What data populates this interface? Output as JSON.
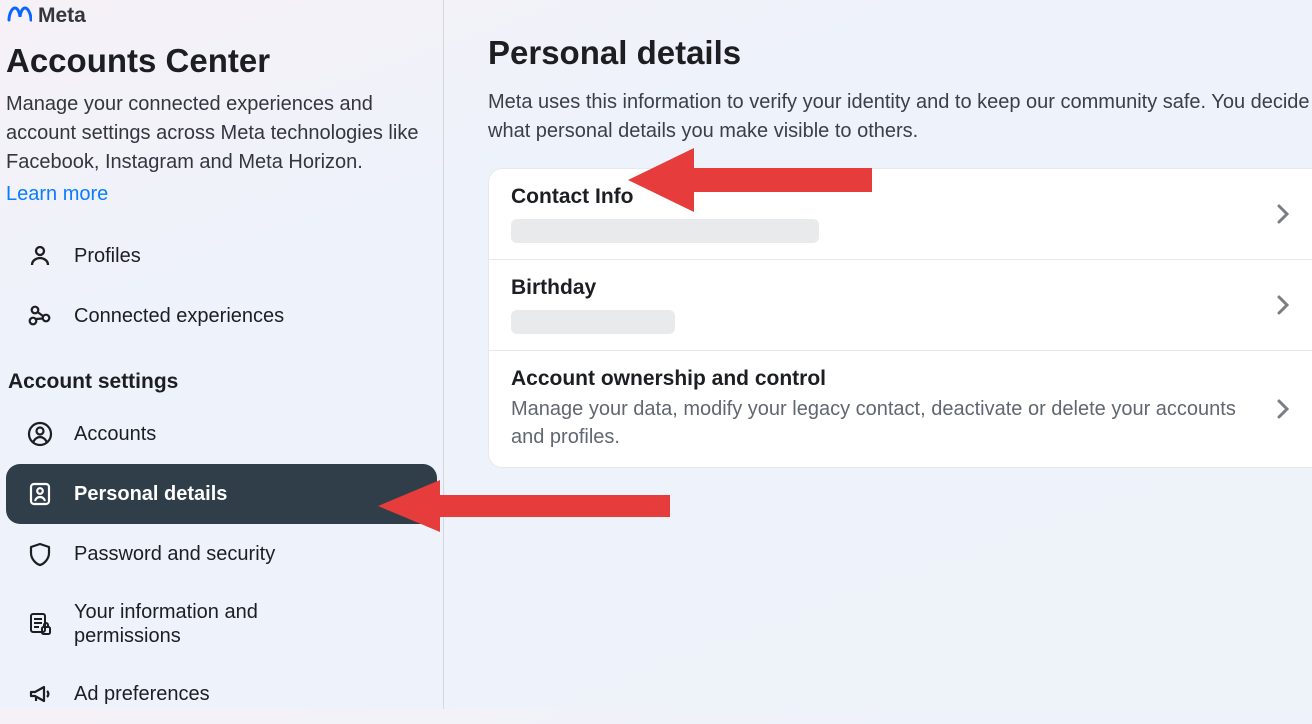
{
  "brand": {
    "name": "Meta"
  },
  "sidebar": {
    "title": "Accounts Center",
    "description": "Manage your connected experiences and account settings across Meta technologies like Facebook, Instagram and Meta Horizon.",
    "learn_more": "Learn more",
    "nav_top": [
      {
        "label": "Profiles"
      },
      {
        "label": "Connected experiences"
      }
    ],
    "settings_label": "Account settings",
    "nav_settings": [
      {
        "label": "Accounts"
      },
      {
        "label": "Personal details"
      },
      {
        "label": "Password and security"
      },
      {
        "label_line1": "Your information and",
        "label_line2": "permissions"
      },
      {
        "label": "Ad preferences"
      }
    ]
  },
  "content": {
    "title": "Personal details",
    "description": "Meta uses this information to verify your identity and to keep our community safe. You decide what personal details you make visible to others.",
    "rows": {
      "contact": {
        "title": "Contact Info"
      },
      "birthday": {
        "title": "Birthday"
      },
      "ownership": {
        "title": "Account ownership and control",
        "subtitle": "Manage your data, modify your legacy contact, deactivate or delete your accounts and profiles."
      }
    }
  }
}
